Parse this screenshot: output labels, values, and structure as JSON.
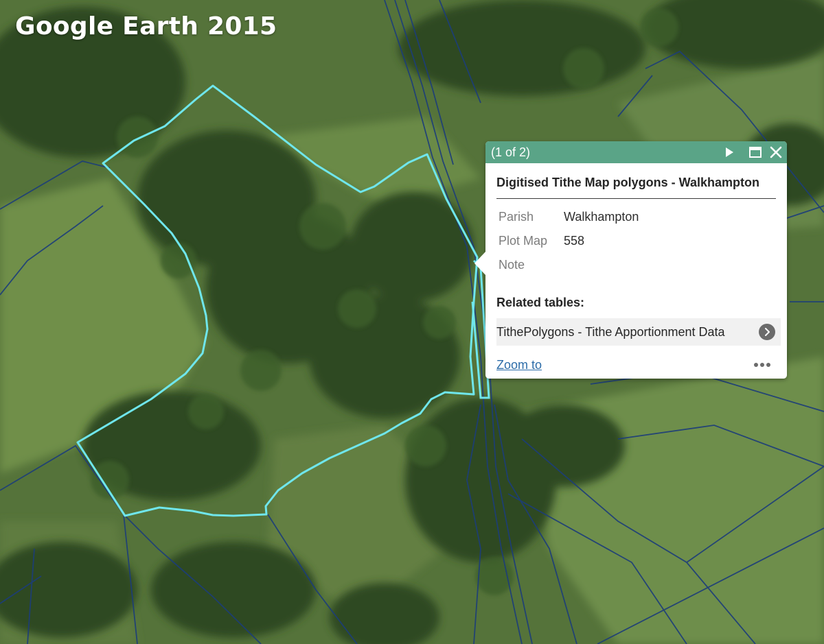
{
  "map": {
    "overlay_title": "Google Earth 2015",
    "colors": {
      "selected_polygon": "#6fe6ec",
      "parcel_lines": "#1c3d7a"
    }
  },
  "popup": {
    "feature_count": "(1 of 2)",
    "layer_title": "Digitised Tithe Map polygons - Walkhampton",
    "attributes": [
      {
        "key": "Parish",
        "value": "Walkhampton"
      },
      {
        "key": "Plot Map",
        "value": "558"
      },
      {
        "key": "Note",
        "value": ""
      }
    ],
    "related_heading": "Related tables:",
    "related_items": [
      {
        "label": "TithePolygons - Tithe Apportionment Data"
      }
    ],
    "zoom_label": "Zoom to",
    "icons": {
      "next": "play-icon",
      "maximize": "maximize-icon",
      "close": "close-icon",
      "more": "more-horizontal-icon",
      "related_go": "chevron-right-icon"
    },
    "colors": {
      "header": "#5aa487",
      "link": "#2c6ca8"
    }
  }
}
